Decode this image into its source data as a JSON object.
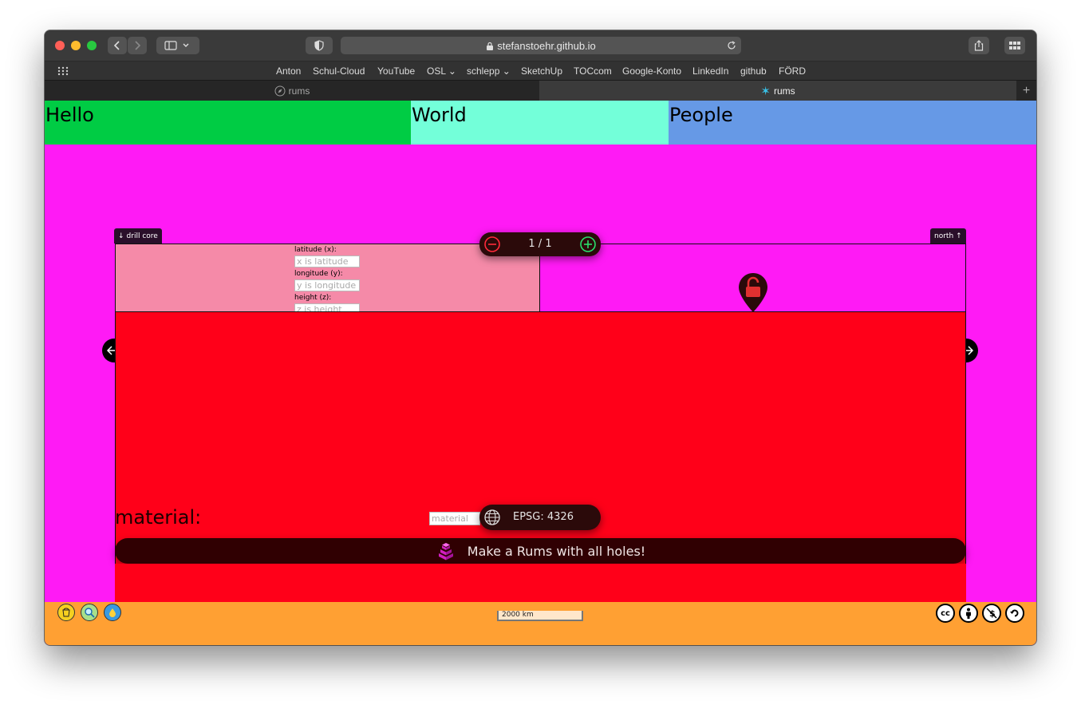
{
  "browser": {
    "url": "stefanstoehr.github.io",
    "bookmarks": [
      "Anton",
      "Schul-Cloud",
      "YouTube",
      "OSL",
      "schlepp",
      "SketchUp",
      "TOCcom",
      "Google-Konto",
      "LinkedIn",
      "github",
      "FÖRD"
    ],
    "tabs": [
      {
        "label": "rums",
        "active": false
      },
      {
        "label": "rums",
        "active": true
      }
    ],
    "new_tab": "+"
  },
  "header": {
    "items": [
      {
        "label": "Hello",
        "color": "#00cc44"
      },
      {
        "label": "World",
        "color": "#73ffd9"
      },
      {
        "label": "People",
        "color": "#6699e6"
      }
    ]
  },
  "panel": {
    "left_tab": "drill core",
    "right_tab": "north",
    "pager": {
      "text": "1 / 1"
    },
    "coords": {
      "lat_label": "latitude (x):",
      "lat_placeholder": "x is latitude",
      "lon_label": "longitude (y):",
      "lon_placeholder": "y is longitude",
      "height_label": "height (z):",
      "height_placeholder": "z is height"
    },
    "material_label": "material:",
    "material_placeholder": "material",
    "epsg": "EPSG: 4326",
    "make_button": "Make a Rums with all holes!"
  },
  "footer": {
    "scale": "2000 km"
  },
  "colors": {
    "page_bg": "#ff1af5",
    "panel_red": "#ff0019",
    "coord_bg": "#f58aa8",
    "footer": "#ffa033"
  },
  "icons": [
    "bucket-icon",
    "search-globe-icon",
    "water-drop-icon",
    "cc-icon",
    "attribution-icon",
    "noncommercial-icon",
    "sharealike-icon",
    "globe-icon",
    "layers-icon",
    "unlock-marker-icon",
    "minus-icon",
    "plus-icon"
  ]
}
